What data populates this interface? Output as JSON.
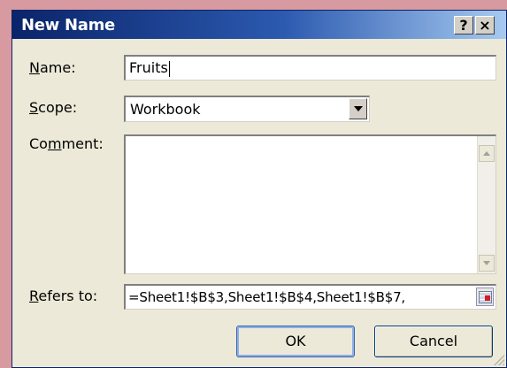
{
  "window": {
    "title": "New Name",
    "help_label": "?",
    "close_label": "×"
  },
  "form": {
    "name_label_accel": "N",
    "name_label_rest": "ame:",
    "name_value": "Fruits",
    "scope_label_accel": "S",
    "scope_label_rest": "cope:",
    "scope_value": "Workbook",
    "comment_label_pre": "Co",
    "comment_label_accel": "m",
    "comment_label_rest": "ment:",
    "comment_value": "",
    "refers_label_accel": "R",
    "refers_label_rest": "efers to:",
    "refers_value": "=Sheet1!$B$3,Sheet1!$B$4,Sheet1!$B$7,"
  },
  "buttons": {
    "ok_label": "OK",
    "cancel_label": "Cancel"
  },
  "icons": {
    "help": "help-icon",
    "close": "close-icon",
    "dropdown": "chevron-down-icon",
    "scroll_up": "scroll-up-arrow-icon",
    "scroll_down": "scroll-down-arrow-icon",
    "range_select": "range-select-icon"
  },
  "colors": {
    "titlebar_start": "#0a246a",
    "titlebar_end": "#a6caf0",
    "dialog_bg": "#ece9d8",
    "background": "#d79aa0"
  }
}
